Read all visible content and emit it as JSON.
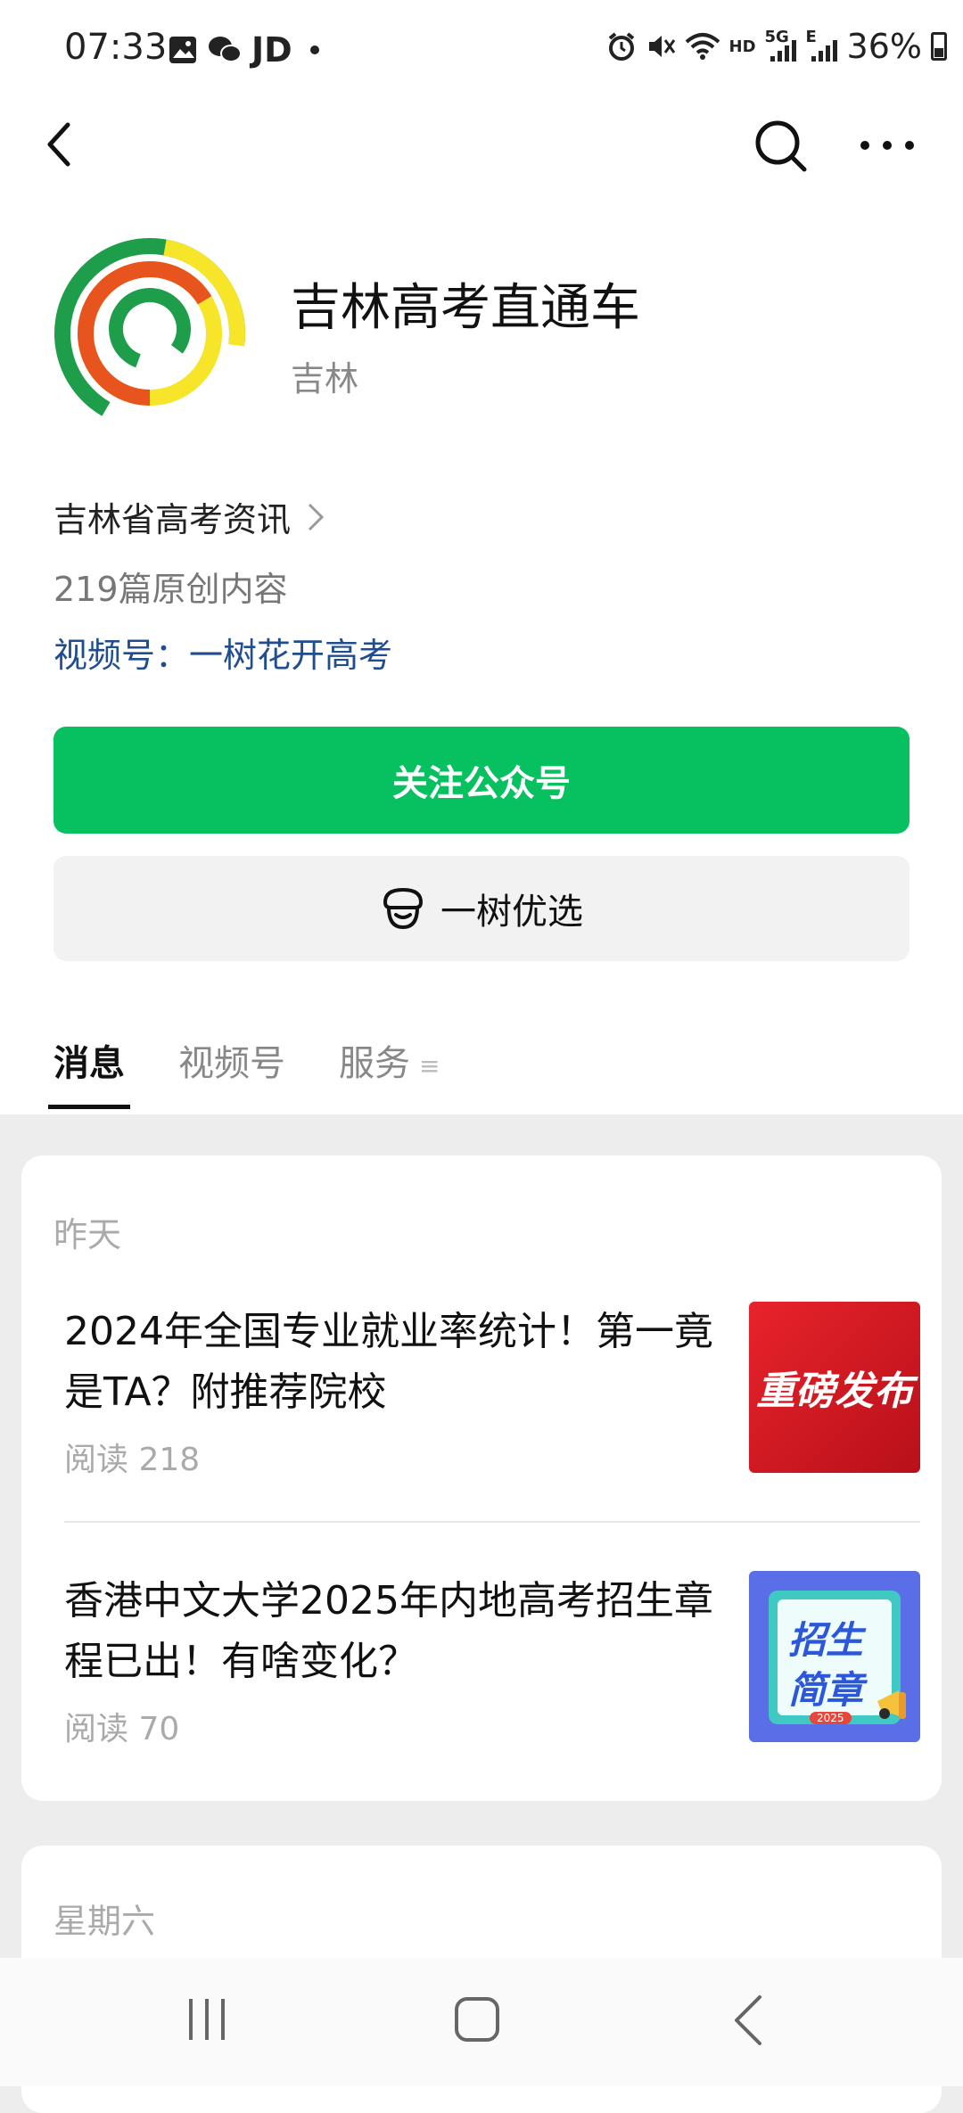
{
  "status_bar": {
    "time": "07:33",
    "carrier_label": "JD",
    "network_hd": "HD",
    "network_5g": "5G",
    "network_e": "E",
    "battery": "36%"
  },
  "account": {
    "name": "吉林高考直通车",
    "region": "吉林",
    "description": "吉林省高考资讯",
    "original_count": "219篇原创内容",
    "video_channel": "视频号：一树花开高考",
    "follow_label": "关注公众号",
    "shop_label": "一树优选"
  },
  "tabs": [
    {
      "label": "消息",
      "active": true
    },
    {
      "label": "视频号",
      "active": false
    },
    {
      "label": "服务",
      "active": false
    }
  ],
  "tab_menu_glyph": "≡",
  "feed": {
    "groups": [
      {
        "date": "昨天",
        "articles": [
          {
            "title": "2024年全国专业就业率统计！第一竟是TA？附推荐院校",
            "reads": "阅读 218",
            "thumb_text": "重磅发布"
          },
          {
            "title": "香港中文大学2025年内地高考招生章程已出！有啥变化？",
            "reads": "阅读 70",
            "thumb_text_1": "招生",
            "thumb_text_2": "简章",
            "thumb_year": "2025"
          }
        ]
      },
      {
        "date": "星期六"
      }
    ]
  },
  "colors": {
    "brand_green": "#07c160",
    "link_blue": "#1f4d8f",
    "logo_green": "#1e9e4a",
    "logo_yellow": "#f7e52a",
    "logo_orange": "#e8541e"
  },
  "icons": [
    "back-arrow-icon",
    "search-icon",
    "more-icon",
    "chevron-right-icon",
    "shop-icon",
    "recent-apps-icon",
    "home-icon",
    "system-back-icon"
  ]
}
